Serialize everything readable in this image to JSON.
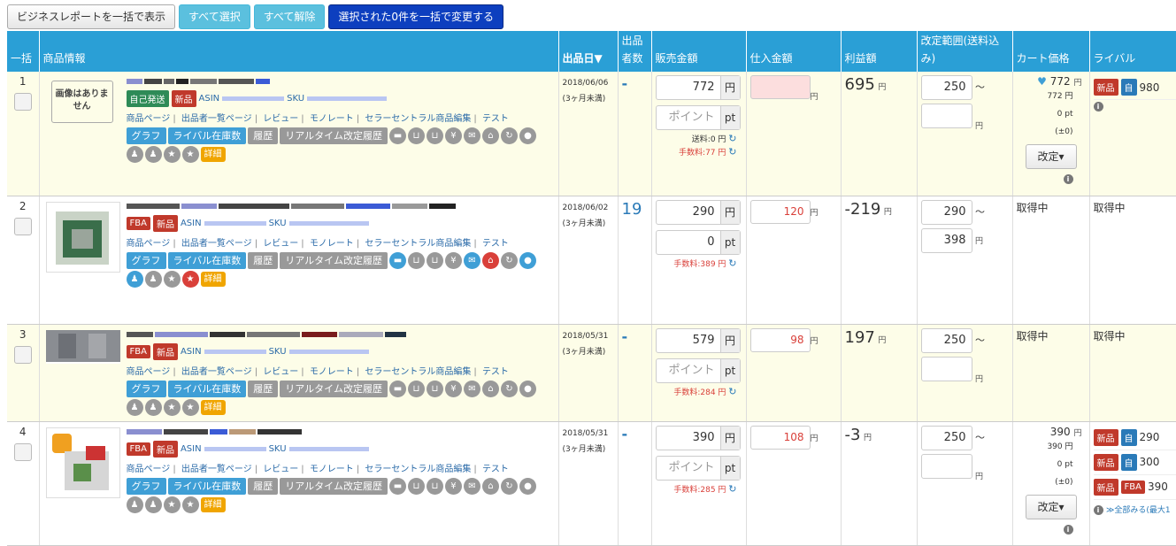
{
  "toolbar": {
    "business_report": "ビジネスレポートを一括で表示",
    "select_all": "すべて選択",
    "deselect_all": "すべて解除",
    "bulk_change": "選択された0件を一括で変更する"
  },
  "headers": {
    "bulk": "一括",
    "product": "商品情報",
    "listed_date": "出品日▼",
    "sellers": "出品者数",
    "sell_price": "販売金額",
    "cost": "仕入金額",
    "profit": "利益額",
    "range": "改定範囲(送料込み)",
    "cart": "カート価格",
    "rival": "ライバル"
  },
  "labels": {
    "no_image": "画像はありません",
    "asin": "ASIN",
    "sku": "SKU",
    "links": [
      "商品ページ",
      "出品者一覧ページ",
      "レビュー",
      "モノレート",
      "セラーセントラル商品編集",
      "テスト"
    ],
    "graph": "グラフ",
    "rival_stock": "ライバル在庫数",
    "history": "履歴",
    "realtime_history": "リアルタイム改定履歴",
    "detail": "詳細",
    "yen": "円",
    "pt": "pt",
    "point_placeholder": "ポイント",
    "tilde": "〜",
    "revise": "改定▾",
    "acquiring": "取得中",
    "new": "新品",
    "self_ship": "自己発送",
    "fba": "FBA",
    "jiko": "自",
    "see_all": "≫全部みる(最大1"
  },
  "rows": [
    {
      "num": "1",
      "ship": "自己発送",
      "date": "2018/06/06",
      "age": "(3ヶ月未満)",
      "sellers": "-",
      "price": "772",
      "point": "",
      "shipping_fee": "送料:0 円",
      "fee": "手数料:77 円",
      "cost": "",
      "profit": "695",
      "range_min": "250",
      "range_max": "",
      "cart_price": "772",
      "cart_base": "772 円",
      "cart_pt": "0 pt",
      "cart_diff": "(±0)",
      "rivals": [
        {
          "cond": "新品",
          "type": "自",
          "price": "980"
        }
      ]
    },
    {
      "num": "2",
      "ship": "FBA",
      "date": "2018/06/02",
      "age": "(3ヶ月未満)",
      "sellers": "19",
      "price": "290",
      "point": "0",
      "shipping_fee": "",
      "fee": "手数料:389 円",
      "cost": "120",
      "profit": "-219",
      "range_min": "290",
      "range_max": "398",
      "cart_price": "取得中",
      "rival_text": "取得中"
    },
    {
      "num": "3",
      "ship": "FBA",
      "date": "2018/05/31",
      "age": "(3ヶ月未満)",
      "sellers": "-",
      "price": "579",
      "point": "",
      "shipping_fee": "",
      "fee": "手数料:284 円",
      "cost": "98",
      "profit": "197",
      "range_min": "250",
      "range_max": "",
      "cart_price": "取得中",
      "rival_text": "取得中"
    },
    {
      "num": "4",
      "ship": "FBA",
      "date": "2018/05/31",
      "age": "(3ヶ月未満)",
      "sellers": "-",
      "price": "390",
      "point": "",
      "shipping_fee": "",
      "fee": "手数料:285 円",
      "cost": "108",
      "profit": "-3",
      "range_min": "250",
      "range_max": "",
      "cart_price": "390",
      "cart_base": "390 円",
      "cart_pt": "0 pt",
      "cart_diff": "(±0)",
      "rivals": [
        {
          "cond": "新品",
          "type": "自",
          "price": "290"
        },
        {
          "cond": "新品",
          "type": "自",
          "price": "300"
        },
        {
          "cond": "新品",
          "type": "FBA",
          "price": "390"
        }
      ]
    }
  ],
  "colors": {
    "header_bg": "#2a9fd6",
    "primary_button": "#0d3fbf",
    "info_button": "#5bc0de",
    "row_highlight": "#fdfde8",
    "new_tag": "#c0392b",
    "detail_badge": "#f0a500"
  }
}
